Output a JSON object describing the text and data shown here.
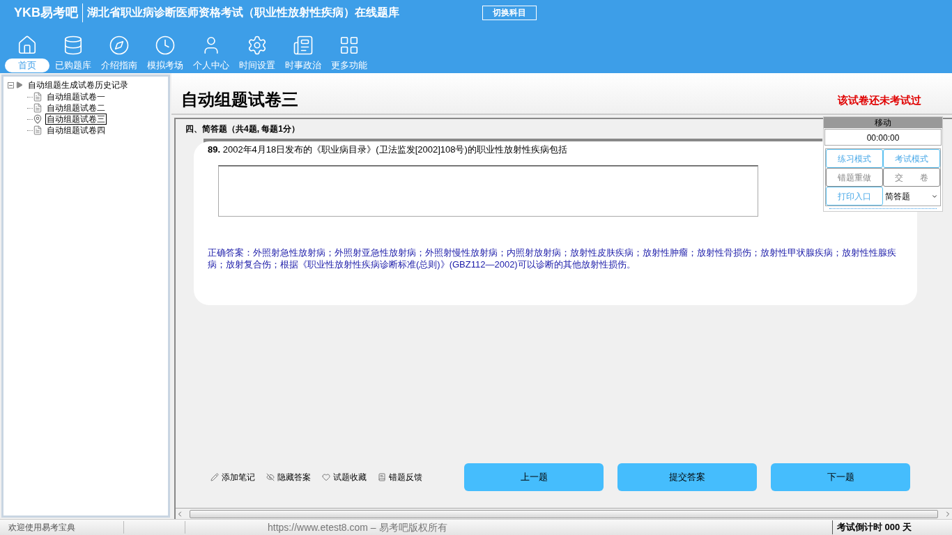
{
  "header": {
    "logo": "YKB易考吧",
    "title": "湖北省职业病诊断医师资格考试（职业性放射性疾病）在线题库",
    "switch_button": "切换科目"
  },
  "nav": [
    {
      "label": "首页",
      "selected": true
    },
    {
      "label": "已购题库",
      "selected": false
    },
    {
      "label": "介绍指南",
      "selected": false
    },
    {
      "label": "模拟考场",
      "selected": false
    },
    {
      "label": "个人中心",
      "selected": false
    },
    {
      "label": "时间设置",
      "selected": false
    },
    {
      "label": "时事政治",
      "selected": false
    },
    {
      "label": "更多功能",
      "selected": false
    }
  ],
  "tree": {
    "label": "自动组题生成试卷历史记录",
    "expanded": true,
    "children": [
      {
        "label": "自动组题试卷一",
        "selected": false
      },
      {
        "label": "自动组题试卷二",
        "selected": false
      },
      {
        "label": "自动组题试卷三",
        "selected": true
      },
      {
        "label": "自动组题试卷四",
        "selected": false
      }
    ]
  },
  "paper": {
    "title": "自动组题试卷三",
    "status": "该试卷还未考试过",
    "section": "四、简答题（共4题, 每题1分）"
  },
  "question": {
    "number": "89.",
    "text": "2002年4月18日发布的《职业病目录》(卫法监发[2002]108号)的职业性放射性疾病包括",
    "answer": "正确答案：外照射急性放射病；外照射亚急性放射病；外照射慢性放射病；内照射放射病；放射性皮肤疾病；放射性肿瘤；放射性骨损伤；放射性甲状腺疾病；放射性性腺疾病；放射复合伤；根据《职业性放射性疾病诊断标准(总则)》(GBZ112—2002)可以诊断的其他放射性损伤。"
  },
  "panel": {
    "move": "移动",
    "timer": "00:00:00",
    "buttons": [
      {
        "label": "练习模式",
        "disabled": false
      },
      {
        "label": "考试模式",
        "disabled": false
      },
      {
        "label": "错题重做",
        "disabled": true
      },
      {
        "label": "交　　卷",
        "disabled": true
      },
      {
        "label": "打印入口",
        "disabled": false
      }
    ],
    "type_select": "简答题"
  },
  "actions": [
    "添加笔记",
    "隐藏答案",
    "试题收藏",
    "错题反馈"
  ],
  "nav_buttons": [
    "上一题",
    "提交答案",
    "下一题"
  ],
  "status_bar": {
    "welcome": "欢迎使用易考宝典",
    "copyright": "https://www.etest8.com – 易考吧版权所有",
    "countdown": "考试倒计时 000 天"
  }
}
